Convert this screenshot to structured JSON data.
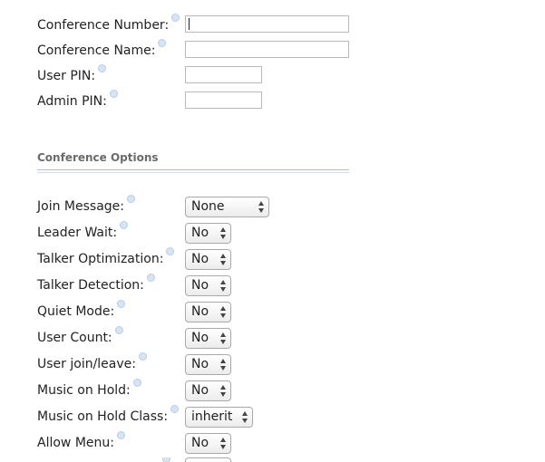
{
  "fields": [
    {
      "label": "Conference Number:",
      "value": "",
      "focused": true
    },
    {
      "label": "Conference Name:",
      "value": ""
    },
    {
      "label": "User PIN:",
      "value": ""
    },
    {
      "label": "Admin PIN:",
      "value": ""
    }
  ],
  "section": {
    "title": "Conference Options"
  },
  "options": [
    {
      "label": "Join Message:",
      "value": "None"
    },
    {
      "label": "Leader Wait:",
      "value": "No"
    },
    {
      "label": "Talker Optimization:",
      "value": "No"
    },
    {
      "label": "Talker Detection:",
      "value": "No"
    },
    {
      "label": "Quiet Mode:",
      "value": "No"
    },
    {
      "label": "User Count:",
      "value": "No"
    },
    {
      "label": "User join/leave:",
      "value": "No"
    },
    {
      "label": "Music on Hold:",
      "value": "No"
    },
    {
      "label": "Music on Hold Class:",
      "value": "inherit"
    },
    {
      "label": "Allow Menu:",
      "value": "No"
    }
  ],
  "colors": {
    "help_icon": "#d6e4f3",
    "section_rule": "#a9c3de",
    "section_title": "#6b6b6b"
  },
  "icons": {
    "help": "help-icon",
    "select_arrows": "select-arrows-icon"
  }
}
